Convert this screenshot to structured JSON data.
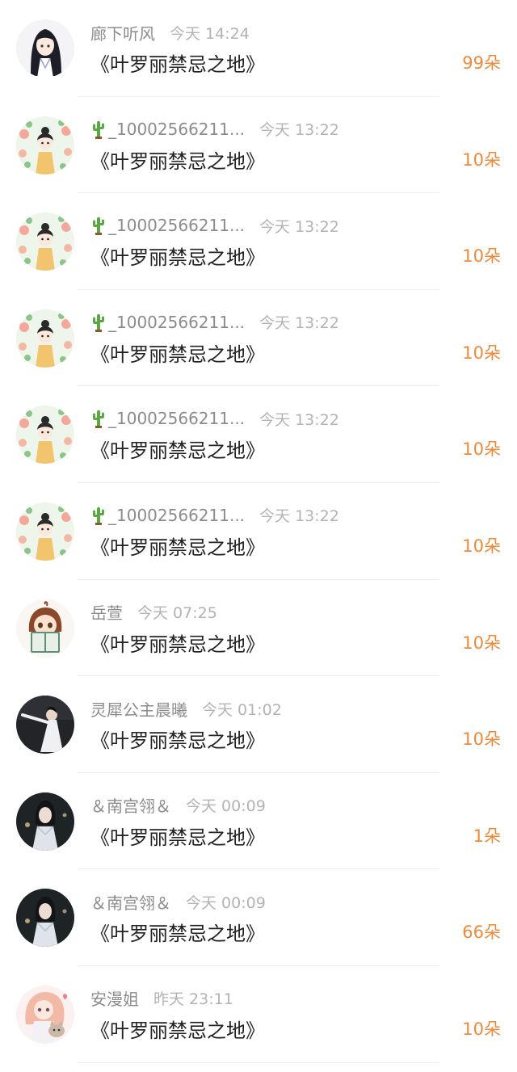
{
  "colors": {
    "count": "#ee8a3a",
    "name": "#8c8c8c",
    "time": "#b3b3b3",
    "title": "#222222",
    "divider": "#f1f1f1"
  },
  "items": [
    {
      "name": "廊下听风",
      "has_cactus": false,
      "time": "今天 14:24",
      "gift": "《叶罗丽禁忌之地》",
      "count": "99朵",
      "avatar_icon": "anime-girl-black-hair-icon"
    },
    {
      "name": "_10002566211...",
      "has_cactus": true,
      "time": "今天 13:22",
      "gift": "《叶罗丽禁忌之地》",
      "count": "10朵",
      "avatar_icon": "floral-girl-icon"
    },
    {
      "name": "_10002566211...",
      "has_cactus": true,
      "time": "今天 13:22",
      "gift": "《叶罗丽禁忌之地》",
      "count": "10朵",
      "avatar_icon": "floral-girl-icon"
    },
    {
      "name": "_10002566211...",
      "has_cactus": true,
      "time": "今天 13:22",
      "gift": "《叶罗丽禁忌之地》",
      "count": "10朵",
      "avatar_icon": "floral-girl-icon"
    },
    {
      "name": "_10002566211...",
      "has_cactus": true,
      "time": "今天 13:22",
      "gift": "《叶罗丽禁忌之地》",
      "count": "10朵",
      "avatar_icon": "floral-girl-icon"
    },
    {
      "name": "_10002566211...",
      "has_cactus": true,
      "time": "今天 13:22",
      "gift": "《叶罗丽禁忌之地》",
      "count": "10朵",
      "avatar_icon": "floral-girl-icon"
    },
    {
      "name": "岳萱",
      "has_cactus": false,
      "time": "今天 07:25",
      "gift": "《叶罗丽禁忌之地》",
      "count": "10朵",
      "avatar_icon": "girl-reading-book-icon"
    },
    {
      "name": "灵犀公主晨曦",
      "has_cactus": false,
      "time": "今天 01:02",
      "gift": "《叶罗丽禁忌之地》",
      "count": "10朵",
      "avatar_icon": "dancer-photo-icon"
    },
    {
      "name": "＆南宫翎＆",
      "has_cactus": false,
      "time": "今天 00:09",
      "gift": "《叶罗丽禁忌之地》",
      "count": "1朵",
      "avatar_icon": "woman-white-dress-photo-icon"
    },
    {
      "name": "＆南宫翎＆",
      "has_cactus": false,
      "time": "今天 00:09",
      "gift": "《叶罗丽禁忌之地》",
      "count": "66朵",
      "avatar_icon": "woman-white-dress-photo-icon"
    },
    {
      "name": "安漫姐",
      "has_cactus": false,
      "time": "昨天 23:11",
      "gift": "《叶罗丽禁忌之地》",
      "count": "10朵",
      "avatar_icon": "anime-girl-with-cat-icon"
    }
  ]
}
